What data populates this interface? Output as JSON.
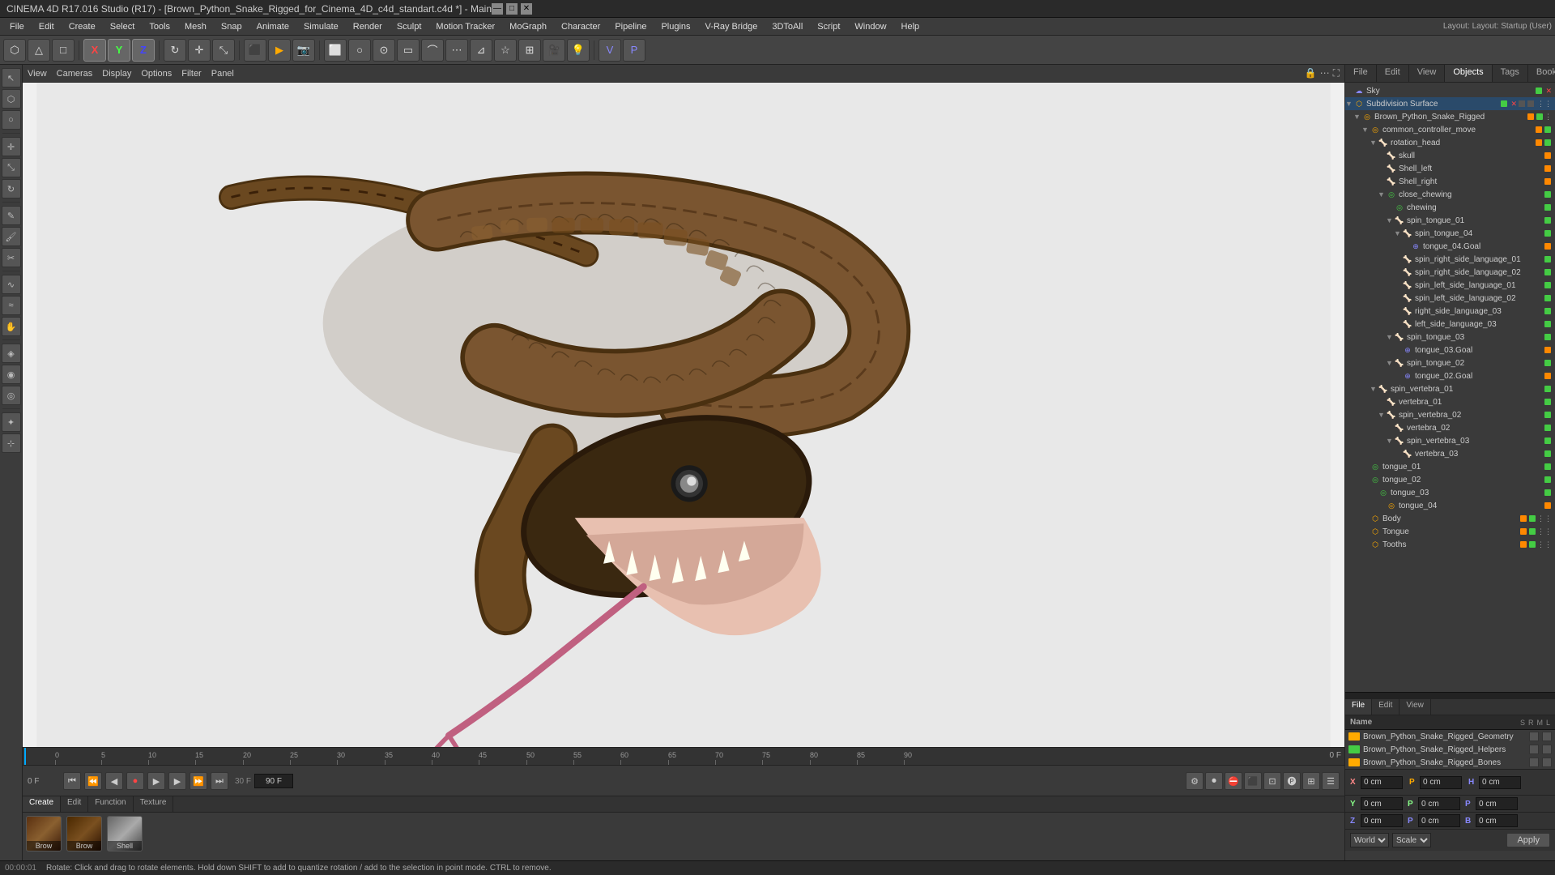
{
  "window": {
    "title": "CINEMA 4D R17.016 Studio (R17) - [Brown_Python_Snake_Rigged_for_Cinema_4D_c4d_standart.c4d *] - Main"
  },
  "titlebar": {
    "minimize": "—",
    "maximize": "□",
    "close": "✕"
  },
  "menubar": {
    "items": [
      "File",
      "Edit",
      "Create",
      "Select",
      "Tools",
      "Mesh",
      "Snap",
      "Animate",
      "Simulate",
      "Render",
      "Sculpt",
      "Motion Tracker",
      "MoGraph",
      "Character",
      "Pipeline",
      "Plugins",
      "V-Ray Bridge",
      "3DToAll",
      "Script",
      "Animate",
      "Window",
      "Help"
    ]
  },
  "layout_label": "Layout: Startup (User)",
  "right_tabs": [
    "File",
    "Edit",
    "View",
    "Objects",
    "Tags",
    "Bookma."
  ],
  "object_tree": [
    {
      "id": "sky",
      "label": "Sky",
      "indent": 0,
      "has_children": false,
      "icon": "sky",
      "color": "green"
    },
    {
      "id": "subdivision",
      "label": "Subdivision Surface",
      "indent": 0,
      "has_children": true,
      "icon": "hyper",
      "color": "green",
      "selected": false
    },
    {
      "id": "snake_rig",
      "label": "Brown_Python_Snake_Rigged",
      "indent": 1,
      "has_children": true,
      "icon": "null",
      "color": "orange"
    },
    {
      "id": "common_ctrl",
      "label": "common_controller_move",
      "indent": 2,
      "has_children": true,
      "icon": "null",
      "color": "orange"
    },
    {
      "id": "rotation_head",
      "label": "rotation_head",
      "indent": 3,
      "has_children": true,
      "icon": "bone",
      "color": "orange"
    },
    {
      "id": "skull",
      "label": "skull",
      "indent": 4,
      "has_children": false,
      "icon": "bone",
      "color": "orange"
    },
    {
      "id": "shell_left",
      "label": "Shell_left",
      "indent": 4,
      "has_children": false,
      "icon": "bone",
      "color": "orange"
    },
    {
      "id": "shell_right",
      "label": "Shell_right",
      "indent": 4,
      "has_children": false,
      "icon": "bone",
      "color": "orange"
    },
    {
      "id": "close_chewing",
      "label": "close_chewing",
      "indent": 4,
      "has_children": true,
      "icon": "null",
      "color": "green"
    },
    {
      "id": "chewing",
      "label": "chewing",
      "indent": 5,
      "has_children": false,
      "icon": "null",
      "color": "green"
    },
    {
      "id": "spin_tongue_01",
      "label": "spin_tongue_01",
      "indent": 5,
      "has_children": true,
      "icon": "bone",
      "color": "green"
    },
    {
      "id": "spin_tongue_04",
      "label": "spin_tongue_04",
      "indent": 6,
      "has_children": true,
      "icon": "bone",
      "color": "green"
    },
    {
      "id": "tongue_04goal",
      "label": "tongue_04.Goal",
      "indent": 7,
      "has_children": false,
      "icon": "target",
      "color": "orange"
    },
    {
      "id": "spin_right_01",
      "label": "spin_right_side_language_01",
      "indent": 6,
      "has_children": false,
      "icon": "bone",
      "color": "green"
    },
    {
      "id": "spin_right_02",
      "label": "spin_right_side_language_02",
      "indent": 6,
      "has_children": false,
      "icon": "bone",
      "color": "green"
    },
    {
      "id": "spin_left_01",
      "label": "spin_left_side_language_01",
      "indent": 6,
      "has_children": false,
      "icon": "bone",
      "color": "green"
    },
    {
      "id": "spin_left_02",
      "label": "spin_left_side_language_02",
      "indent": 6,
      "has_children": false,
      "icon": "bone",
      "color": "green"
    },
    {
      "id": "right_lang_03",
      "label": "right_side_language_03",
      "indent": 6,
      "has_children": false,
      "icon": "bone",
      "color": "green"
    },
    {
      "id": "left_lang_03",
      "label": "left_side_language_03",
      "indent": 6,
      "has_children": false,
      "icon": "bone",
      "color": "green"
    },
    {
      "id": "spin_tongue_03",
      "label": "spin_tongue_03",
      "indent": 5,
      "has_children": true,
      "icon": "bone",
      "color": "green"
    },
    {
      "id": "tongue_03goal",
      "label": "tongue_03.Goal",
      "indent": 6,
      "has_children": false,
      "icon": "target",
      "color": "orange"
    },
    {
      "id": "spin_tongue_02",
      "label": "spin_tongue_02",
      "indent": 5,
      "has_children": true,
      "icon": "bone",
      "color": "green"
    },
    {
      "id": "tongue_02goal",
      "label": "tongue_02.Goal",
      "indent": 6,
      "has_children": false,
      "icon": "target",
      "color": "orange"
    },
    {
      "id": "spin_vertebra_01",
      "label": "spin_vertebra_01",
      "indent": 3,
      "has_children": true,
      "icon": "bone",
      "color": "green"
    },
    {
      "id": "vertebra_01",
      "label": "vertebra_01",
      "indent": 4,
      "has_children": false,
      "icon": "bone",
      "color": "green"
    },
    {
      "id": "spin_vertebra_02",
      "label": "spin_vertebra_02",
      "indent": 4,
      "has_children": true,
      "icon": "bone",
      "color": "green"
    },
    {
      "id": "vertebra_02",
      "label": "vertebra_02",
      "indent": 5,
      "has_children": false,
      "icon": "bone",
      "color": "green"
    },
    {
      "id": "spin_vertebra_03",
      "label": "spin_vertebra_03",
      "indent": 5,
      "has_children": true,
      "icon": "bone",
      "color": "green"
    },
    {
      "id": "vertebra_03",
      "label": "vertebra_03",
      "indent": 6,
      "has_children": false,
      "icon": "bone",
      "color": "green"
    },
    {
      "id": "tongue_01",
      "label": "tongue_01",
      "indent": 2,
      "has_children": false,
      "icon": "null",
      "color": "green"
    },
    {
      "id": "tongue_02",
      "label": "tongue_02",
      "indent": 2,
      "has_children": false,
      "icon": "null",
      "color": "green"
    },
    {
      "id": "tongue_03",
      "label": "tongue_03",
      "indent": 3,
      "has_children": false,
      "icon": "null",
      "color": "green"
    },
    {
      "id": "tongue_04",
      "label": "tongue_04",
      "indent": 4,
      "has_children": false,
      "icon": "null",
      "color": "orange"
    },
    {
      "id": "body",
      "label": "Body",
      "indent": 2,
      "has_children": false,
      "icon": "mesh",
      "color": "orange"
    },
    {
      "id": "tongue_mat",
      "label": "Tongue",
      "indent": 2,
      "has_children": false,
      "icon": "mesh",
      "color": "orange"
    },
    {
      "id": "tooths",
      "label": "Tooths",
      "indent": 2,
      "has_children": false,
      "icon": "mesh",
      "color": "orange"
    }
  ],
  "viewport_menu": [
    "View",
    "Cameras",
    "Display",
    "Options",
    "Filter",
    "Panel"
  ],
  "timeline": {
    "start": 0,
    "end": 90,
    "current": 0,
    "fps": 30,
    "marks": [
      "0",
      "5",
      "10",
      "15",
      "20",
      "25",
      "30",
      "35",
      "40",
      "45",
      "50",
      "55",
      "60",
      "65",
      "70",
      "75",
      "80",
      "85",
      "90"
    ]
  },
  "playback_controls": {
    "first": "⏮",
    "prev_key": "◀◀",
    "prev": "◀",
    "play": "▶",
    "next": "▶",
    "next_key": "▶▶",
    "last": "⏭",
    "record": "●"
  },
  "coords": {
    "x_label": "X",
    "y_label": "Y",
    "z_label": "Z",
    "x_val": "0 cm",
    "y_val": "0 cm",
    "z_val": "0 cm",
    "px_label": "P",
    "py_label": "P",
    "pz_label": "P",
    "hx": "0 cm",
    "hy": "0 cm",
    "hz": "0 cm",
    "apply": "Apply",
    "coord_system": "World",
    "scale_mode": "Scale"
  },
  "materials": [
    {
      "id": "brow",
      "label": "Brow",
      "color": "#5a3a1a"
    },
    {
      "id": "brow2",
      "label": "Brow",
      "color": "#4a3010"
    },
    {
      "id": "shell",
      "label": "Shell",
      "color": "#888888"
    }
  ],
  "mat_tabs": [
    "Create",
    "Edit",
    "Function",
    "Texture"
  ],
  "lower_tabs": [
    "File",
    "Edit",
    "View"
  ],
  "lower_list": [
    {
      "label": "Brown_Python_Snake_Rigged_Geometry",
      "color": "orange"
    },
    {
      "label": "Brown_Python_Snake_Rigged_Helpers",
      "color": "green"
    },
    {
      "label": "Brown_Python_Snake_Rigged_Bones",
      "color": "orange"
    }
  ],
  "statusbar": {
    "time": "00:00:01",
    "message": "Rotate: Click and drag to rotate elements. Hold down SHIFT to add to quantize rotation / add to the selection in point mode. CTRL to remove."
  }
}
